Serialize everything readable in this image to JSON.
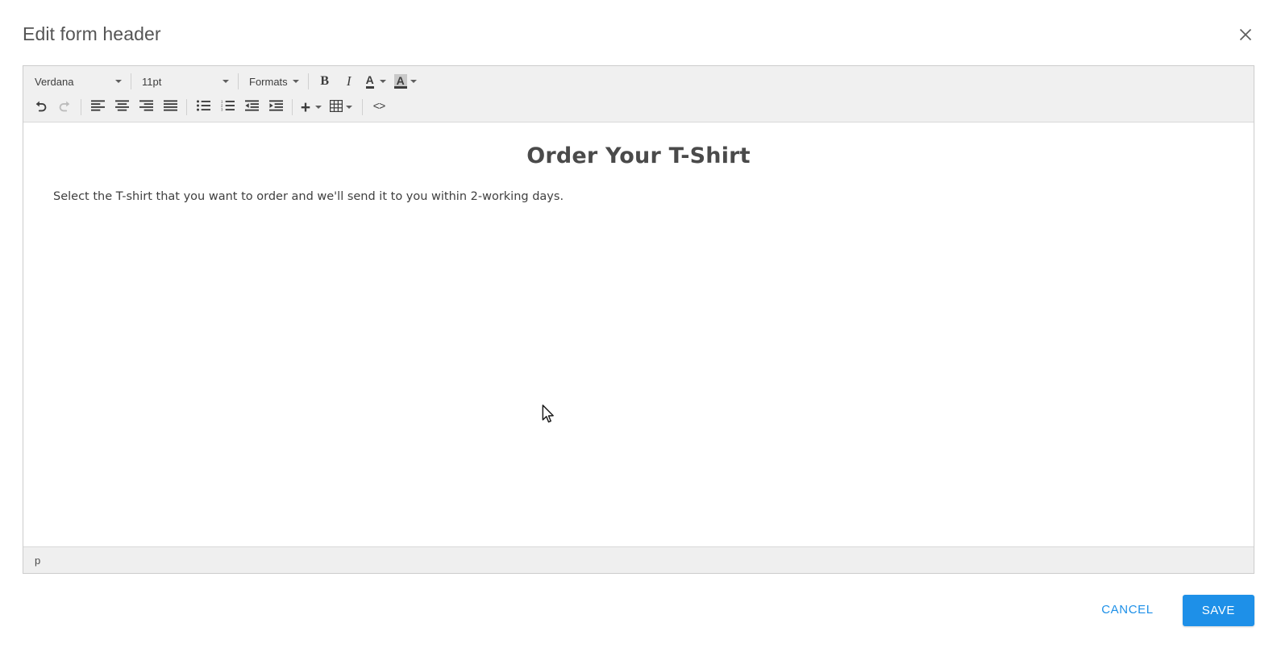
{
  "dialog": {
    "title": "Edit form header",
    "close_icon": "close-icon"
  },
  "toolbar": {
    "row1": {
      "font_family": "Verdana",
      "font_size": "11pt",
      "formats": "Formats",
      "bold": "B",
      "italic": "I",
      "text_color": "A",
      "background_color": "A"
    },
    "row2": {
      "undo": "undo-icon",
      "redo": "redo-icon",
      "align_left": "align-left-icon",
      "align_center": "align-center-icon",
      "align_right": "align-right-icon",
      "align_justify": "align-justify-icon",
      "bullet_list": "bullet-list-icon",
      "numbered_list": "numbered-list-icon",
      "outdent": "outdent-icon",
      "indent": "indent-icon",
      "insert": "plus-icon",
      "table": "table-icon",
      "source_code": "<>"
    }
  },
  "editor": {
    "heading": "Order Your T-Shirt",
    "paragraph": "Select the T-shirt that you want to order and we'll send it to you within 2-working days.",
    "status_path": "p"
  },
  "footer": {
    "cancel_label": "CANCEL",
    "save_label": "SAVE"
  },
  "colors": {
    "accent": "#1e90e8",
    "toolbar_bg": "#f0f0f0",
    "status_bg": "#efefef",
    "border": "#cccccc",
    "title_text": "#555555"
  }
}
